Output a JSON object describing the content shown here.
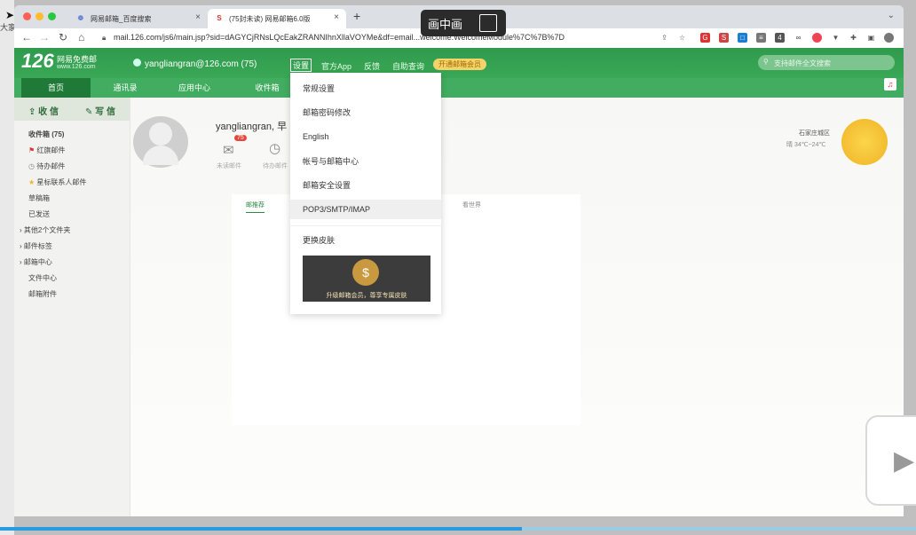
{
  "desktop": {
    "side_text": "大家"
  },
  "browser": {
    "tabs": [
      {
        "title": "网易邮箱_百度搜索",
        "icon": "baidu-icon"
      },
      {
        "title": "(75封未读) 网易邮箱6.0版",
        "icon": "netease-icon"
      }
    ],
    "url": "mail.126.com/js6/main.jsp?sid=dAGYCjRNsLQcEakZRANNIhnXllaVOYMe&df=email...welcome.WelcomeModule%7C%7B%7D"
  },
  "pip": {
    "label": "画中画"
  },
  "mail": {
    "logo": {
      "number": "126",
      "name": "网易免费邮",
      "url": "www.126.com"
    },
    "user": "yangliangran@126.com (75)",
    "top_links": [
      "设置",
      "官方App",
      "反馈",
      "自助查询"
    ],
    "vip_button": "开通邮箱会员",
    "search_placeholder": "支持邮件全文搜索",
    "nav": [
      "首页",
      "通讯录",
      "应用中心",
      "收件箱"
    ],
    "sidebar": {
      "receive": "收 信",
      "compose": "写 信",
      "folders": [
        {
          "label": "收件箱",
          "count": "(75)"
        },
        {
          "label": "红旗邮件"
        },
        {
          "label": "待办邮件"
        },
        {
          "label": "星标联系人邮件"
        },
        {
          "label": "草稿箱"
        },
        {
          "label": "已发送"
        },
        {
          "label": "其他2个文件夹"
        },
        {
          "label": "邮件标签"
        },
        {
          "label": "邮箱中心"
        },
        {
          "label": "文件中心"
        },
        {
          "label": "邮箱附件"
        }
      ]
    },
    "home": {
      "greeting": "yangliangran, 早",
      "unread_badge": "75",
      "unread_label": "未读邮件",
      "todo_label": "待办邮件",
      "tabs": [
        "邮推荐",
        "看世界"
      ]
    },
    "weather": {
      "city": "石家庄城区",
      "temp": "晴 34℃~24℃"
    },
    "settings_menu": {
      "items": [
        "常规设置",
        "邮箱密码修改",
        "English",
        "帐号与邮箱中心",
        "邮箱安全设置",
        "POP3/SMTP/IMAP",
        "更换皮肤"
      ],
      "promo": "升级邮箱会员，尊享专属皮肤"
    }
  },
  "video": {
    "progress_fraction": 0.57
  }
}
